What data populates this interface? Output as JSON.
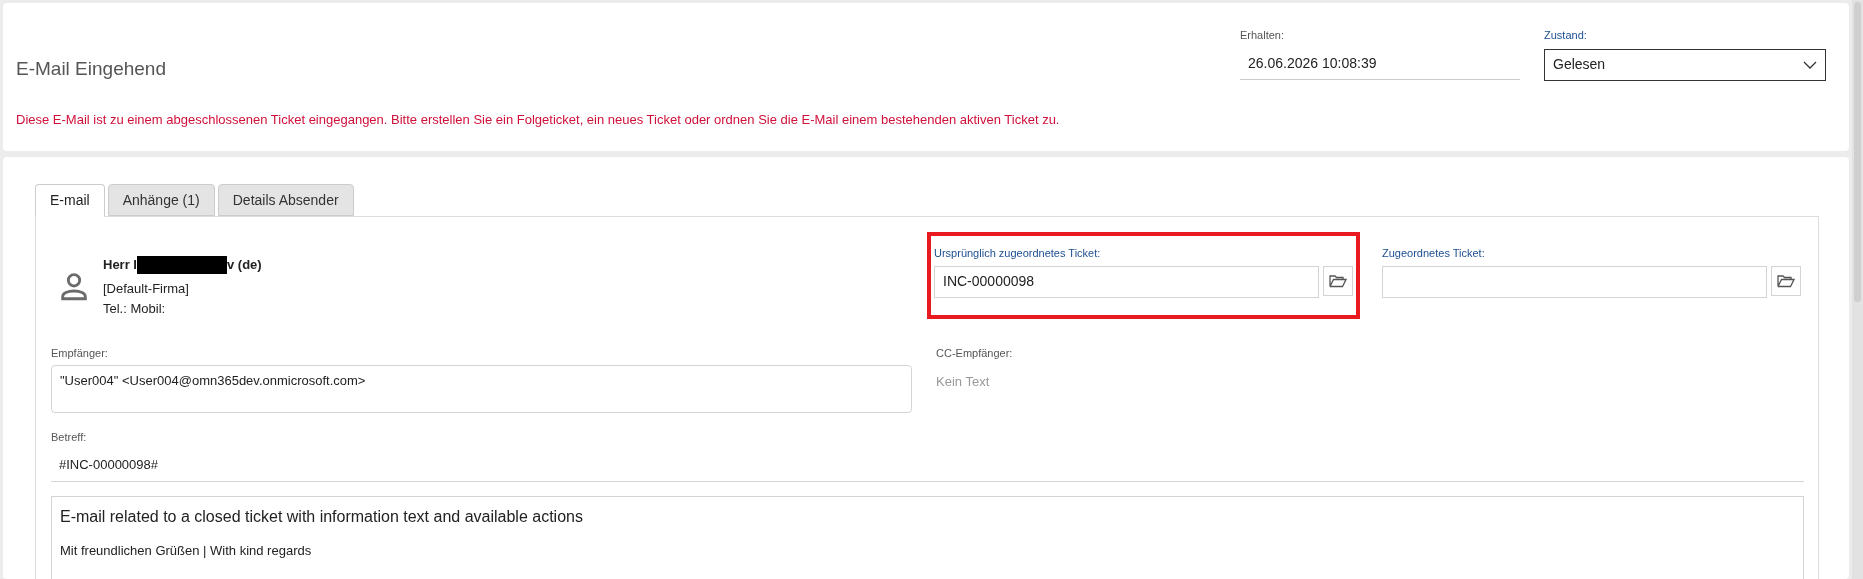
{
  "header": {
    "title": "E-Mail Eingehend",
    "received": {
      "label": "Erhalten:",
      "value": "26.06.2026 10:08:39"
    },
    "status": {
      "label": "Zustand:",
      "value": "Gelesen"
    },
    "warning": "Diese E-Mail ist zu einem abgeschlossenen Ticket eingegangen. Bitte erstellen Sie ein Folgeticket, ein neues Ticket oder ordnen Sie die E-Mail einem bestehenden aktiven Ticket zu."
  },
  "tabs": [
    {
      "label": "E-mail",
      "selected": true
    },
    {
      "label": "Anhänge (1)",
      "selected": false
    },
    {
      "label": "Details Absender",
      "selected": false
    }
  ],
  "sender": {
    "name_start": "Herr I",
    "name_end": "v (de)",
    "company": "[Default-Firma]",
    "phone": "Tel.: Mobil:"
  },
  "ticket_fields": [
    {
      "label": "Ursprünglich zugeordnetes Ticket:",
      "value": "INC-00000098",
      "highlighted": true
    },
    {
      "label": "Zugeordnetes Ticket:",
      "highlighted": false
    }
  ],
  "recipient": {
    "label": "Empfänger:",
    "value": "\"User004\" <User004@omn365dev.onmicrosoft.com>"
  },
  "cc": {
    "label": "CC-Empfänger:",
    "placeholder": "Kein Text"
  },
  "subject": {
    "label": "Betreff:",
    "value": "#INC-00000098#"
  },
  "body": [
    "E-mail related to a closed ticket with information text and available actions",
    "Mit freundlichen Grüßen | With kind regards"
  ]
}
